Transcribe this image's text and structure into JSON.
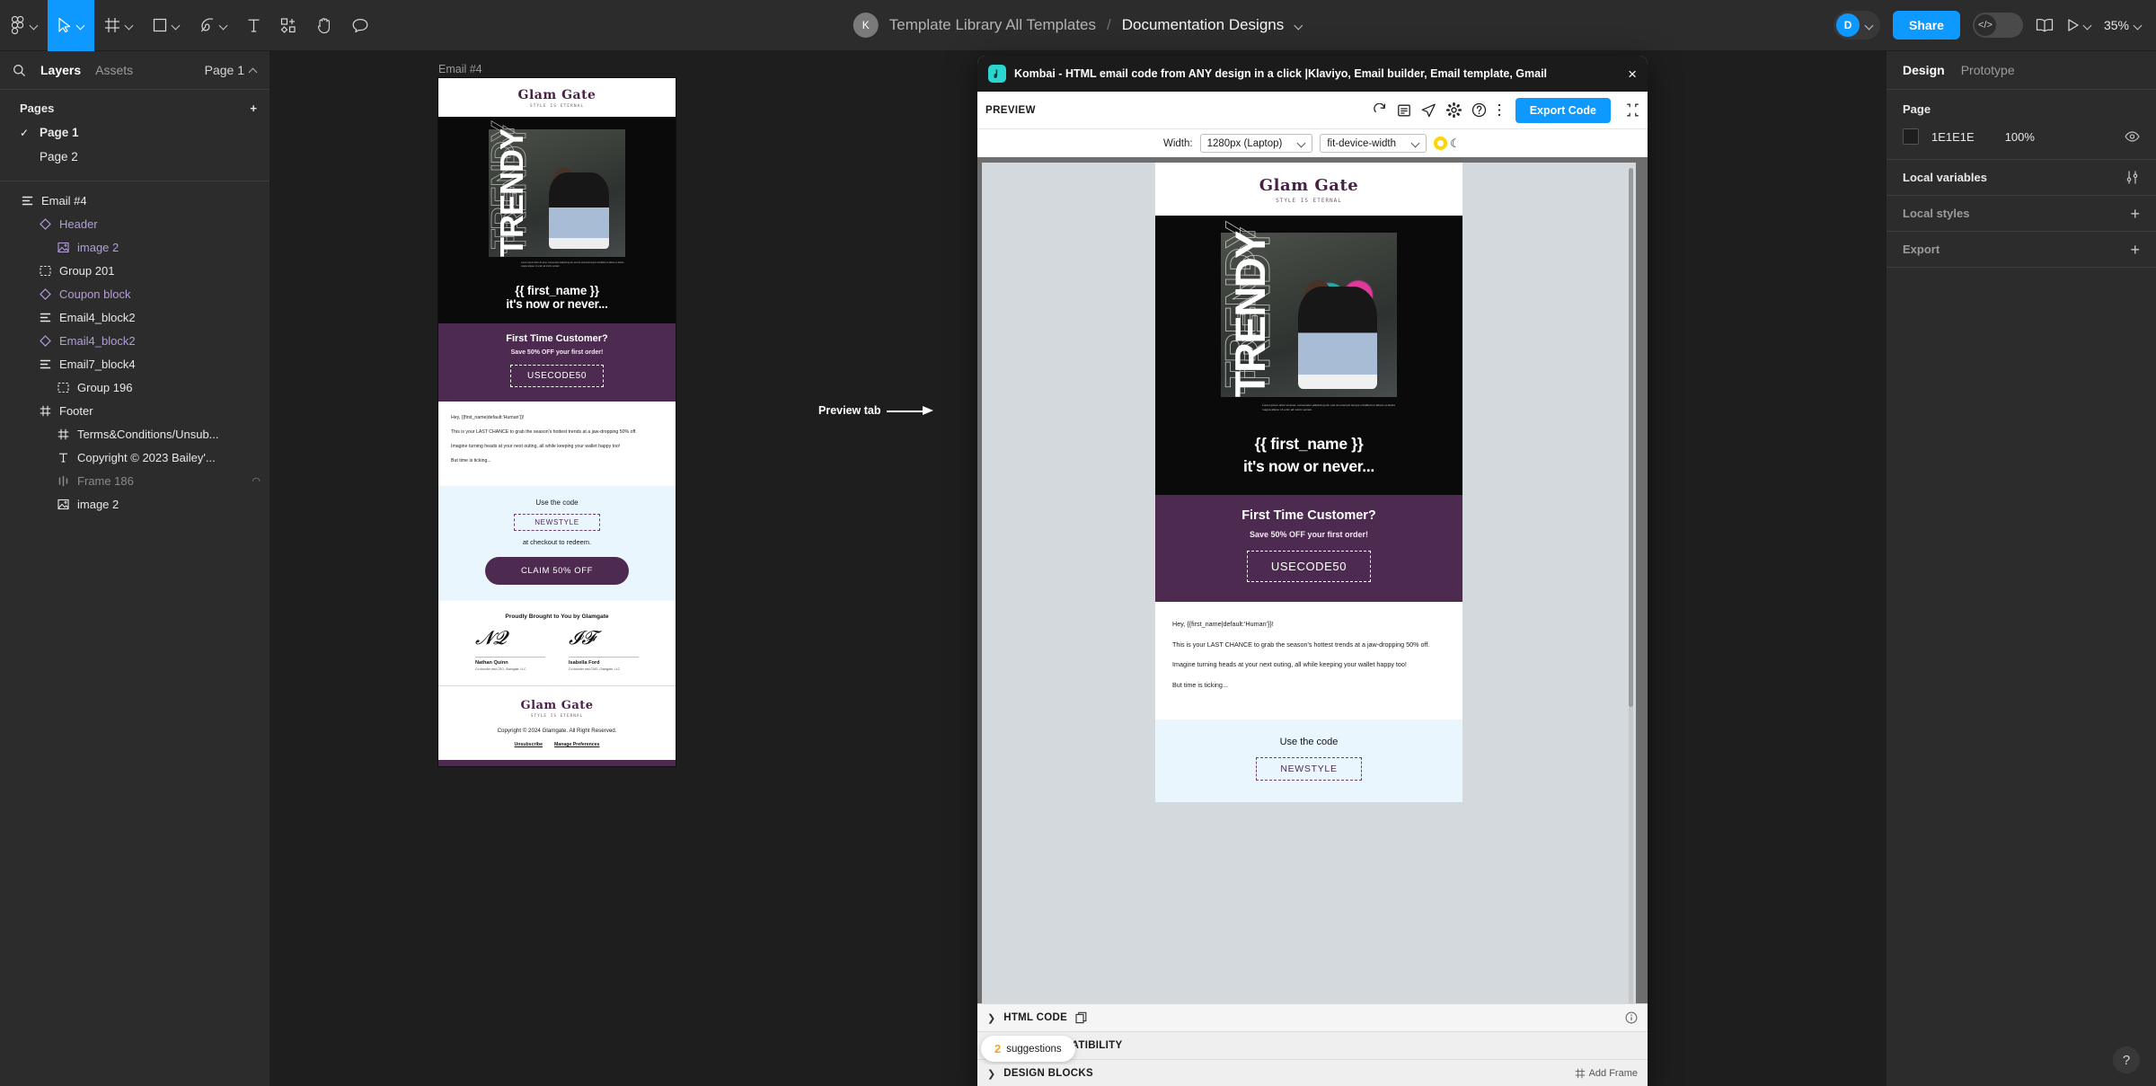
{
  "topbar": {
    "tools": [
      {
        "name": "figma-menu-icon",
        "label": ""
      },
      {
        "name": "move-tool-icon",
        "label": ""
      },
      {
        "name": "frame-tool-icon",
        "label": ""
      },
      {
        "name": "shape-tool-icon",
        "label": ""
      },
      {
        "name": "pen-tool-icon",
        "label": ""
      },
      {
        "name": "text-tool-icon",
        "label": ""
      },
      {
        "name": "resources-tool-icon",
        "label": ""
      },
      {
        "name": "hand-tool-icon",
        "label": ""
      },
      {
        "name": "comment-tool-icon",
        "label": ""
      }
    ],
    "avatar_initial": "K",
    "breadcrumb_project": "Template Library All Templates",
    "breadcrumb_sep": "/",
    "breadcrumb_file": "Documentation Designs",
    "user_initial": "D",
    "share_label": "Share",
    "dev_mode_icon": "</>",
    "zoom_level": "35%"
  },
  "left_panel": {
    "tabs": [
      {
        "label": "Layers",
        "active": true
      },
      {
        "label": "Assets",
        "active": false
      }
    ],
    "page_selector": "Page 1",
    "pages_header": "Pages",
    "pages": [
      {
        "label": "Page 1",
        "selected": true
      },
      {
        "label": "Page 2",
        "selected": false
      }
    ],
    "layers": [
      {
        "label": "Email #4",
        "icon": "autolayout-icon",
        "indent": 0,
        "color": "white",
        "hidden": false
      },
      {
        "label": "Header",
        "icon": "component-icon",
        "indent": 1,
        "color": "purple",
        "hidden": false
      },
      {
        "label": "image 2",
        "icon": "image-icon",
        "indent": 2,
        "color": "purple",
        "hidden": false
      },
      {
        "label": "Group 201",
        "icon": "group-icon",
        "indent": 1,
        "color": "white",
        "hidden": false
      },
      {
        "label": "Coupon block",
        "icon": "component-icon",
        "indent": 1,
        "color": "purple",
        "hidden": false
      },
      {
        "label": "Email4_block2",
        "icon": "autolayout-icon",
        "indent": 1,
        "color": "white",
        "hidden": false
      },
      {
        "label": "Email4_block2",
        "icon": "component-icon",
        "indent": 1,
        "color": "purple",
        "hidden": false
      },
      {
        "label": "Email7_block4",
        "icon": "autolayout-icon",
        "indent": 1,
        "color": "white",
        "hidden": false
      },
      {
        "label": "Group 196",
        "icon": "group-icon",
        "indent": 2,
        "color": "white",
        "hidden": false
      },
      {
        "label": "Footer",
        "icon": "frame-icon",
        "indent": 1,
        "color": "white",
        "hidden": false
      },
      {
        "label": "Terms&Conditions/Unsub...",
        "icon": "frame-icon",
        "indent": 2,
        "color": "white",
        "hidden": false
      },
      {
        "label": "Copyright © 2023 Bailey'...",
        "icon": "text-icon",
        "indent": 2,
        "color": "white",
        "hidden": false
      },
      {
        "label": "Frame 186",
        "icon": "frame-vertical-icon",
        "indent": 2,
        "color": "dim",
        "hidden": true
      },
      {
        "label": "image 2",
        "icon": "image-icon",
        "indent": 2,
        "color": "white",
        "hidden": false
      }
    ]
  },
  "canvas": {
    "frame_label": "Email #4",
    "annotation": "Preview tab",
    "email": {
      "logo": "Glam Gate",
      "logo_tagline": "STYLE IS ETERNAL",
      "hero_word": "TRENDY",
      "hero_caption": "Lorem ipsum dolor sit amet, consectetur adipiscing elit, sed do eiusmod tempor incididunt ut labore et dolore magna aliqua. Ut enim ad minim veniam.",
      "headline_line1": "{{ first_name }}",
      "headline_line2": "it's now or never...",
      "coupon_title": "First Time Customer?",
      "coupon_sub": "Save 50% OFF your first order!",
      "coupon_code": "USECODE50",
      "body_p1": "Hey, {{first_name|default:'Human'}}!",
      "body_p2": "This is your LAST CHANCE to grab the season's hottest trends at a jaw-dropping 50% off.",
      "body_p3": "Imagine turning heads at your next outing, all while keeping your wallet happy too!",
      "body_p4": "But time is ticking...",
      "promo_use": "Use the code",
      "promo_code": "NEWSTYLE",
      "promo_redeem": "at checkout to redeem.",
      "cta_label": "CLAIM 50% OFF",
      "signature_title": "Proudly Brought to You by Glamgate",
      "signatories": [
        {
          "name": "Nathan Quinn",
          "role": "Co-founder and CEO, Glamgate, LLC"
        },
        {
          "name": "Isabella Ford",
          "role": "Co-founder and CMO, Glamgate, LLC"
        }
      ],
      "footer_copyright": "Copyright © 2024 Glamgate. All Right Reserved.",
      "footer_links": [
        "Unsubscribe",
        "Manage Preferences"
      ]
    }
  },
  "plugin": {
    "title": "Kombai - HTML email code from ANY design in a click |Klaviyo, Email builder, Email template, Gmail",
    "logo_icon": "kombai-logo-icon",
    "close_icon": "×",
    "toolbar": {
      "preview_label": "PREVIEW",
      "icons": [
        "refresh-icon",
        "notes-icon",
        "send-icon",
        "gear-icon",
        "help-circle-icon",
        "more-vertical-icon"
      ],
      "export_label": "Export Code",
      "collapse_icon": "collapse-icon"
    },
    "width_bar": {
      "label": "Width:",
      "device": "1280px (Laptop)",
      "fit": "fit-device-width",
      "theme_light_icon": "sun-icon",
      "theme_dark_icon": "moon-icon"
    },
    "suggestions": {
      "count": "2",
      "label": "suggestions"
    },
    "sections": [
      {
        "label": "HTML CODE",
        "right": "",
        "right_icon": "copy-icon",
        "info_icon": "info-icon"
      },
      {
        "label": "EMAIL COMPATIBILITY",
        "right": "",
        "right_icon": "",
        "info_icon": ""
      },
      {
        "label": "DESIGN BLOCKS",
        "right": "Add Frame",
        "right_icon": "frame-hash-icon",
        "info_icon": ""
      }
    ]
  },
  "right_panel": {
    "tabs": [
      {
        "label": "Design",
        "active": true
      },
      {
        "label": "Prototype",
        "active": false
      }
    ],
    "page_section_title": "Page",
    "page_fill_hex": "1E1E1E",
    "page_fill_opacity": "100%",
    "rows": [
      {
        "label": "Local variables",
        "action": "variables-icon",
        "dim": false
      },
      {
        "label": "Local styles",
        "action": "+",
        "dim": true
      },
      {
        "label": "Export",
        "action": "+",
        "dim": true
      }
    ],
    "help_label": "?"
  }
}
